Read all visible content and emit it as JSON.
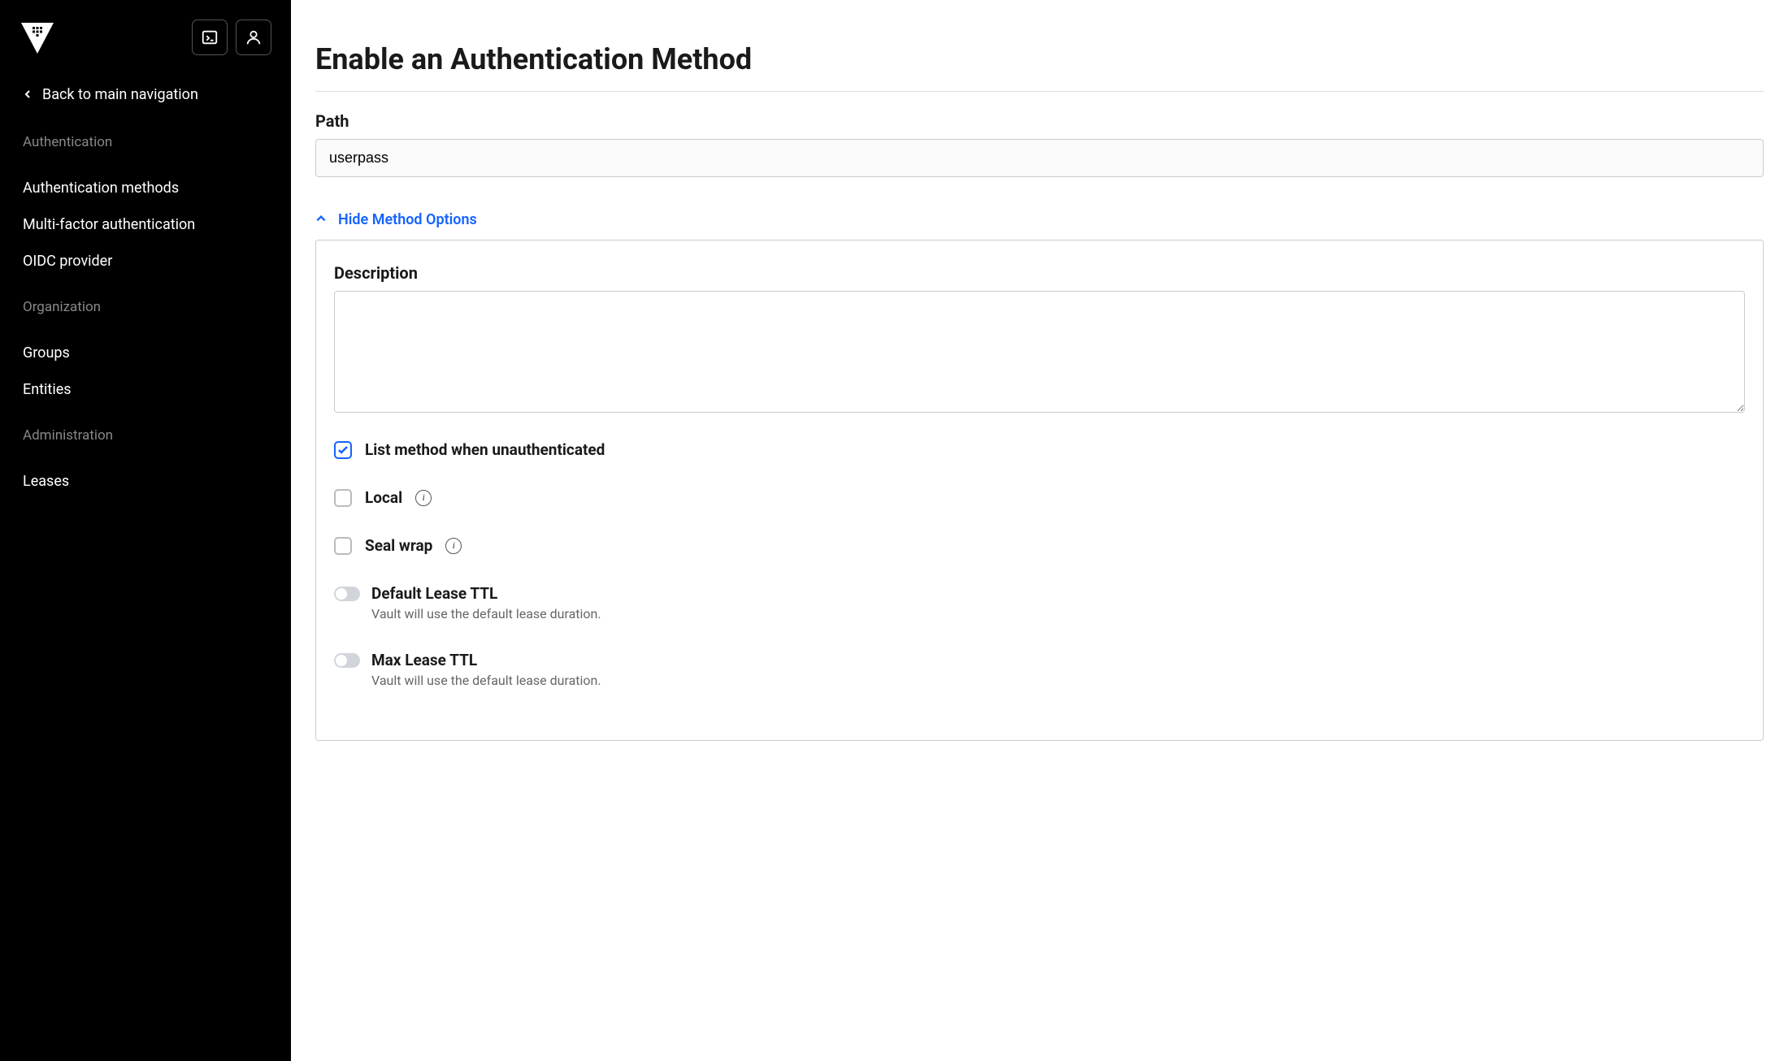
{
  "sidebar": {
    "back_label": "Back to main navigation",
    "sections": [
      {
        "title": "Authentication",
        "items": [
          "Authentication methods",
          "Multi-factor authentication",
          "OIDC provider"
        ]
      },
      {
        "title": "Organization",
        "items": [
          "Groups",
          "Entities"
        ]
      },
      {
        "title": "Administration",
        "items": [
          "Leases"
        ]
      }
    ]
  },
  "page": {
    "title": "Enable an Authentication Method",
    "path_label": "Path",
    "path_value": "userpass",
    "toggle_label": "Hide Method Options",
    "description_label": "Description",
    "description_value": "",
    "checkboxes": {
      "list_unauth": {
        "label": "List method when unauthenticated",
        "checked": true
      },
      "local": {
        "label": "Local",
        "checked": false
      },
      "seal_wrap": {
        "label": "Seal wrap",
        "checked": false
      }
    },
    "toggles": {
      "default_ttl": {
        "label": "Default Lease TTL",
        "hint": "Vault will use the default lease duration."
      },
      "max_ttl": {
        "label": "Max Lease TTL",
        "hint": "Vault will use the default lease duration."
      }
    }
  }
}
